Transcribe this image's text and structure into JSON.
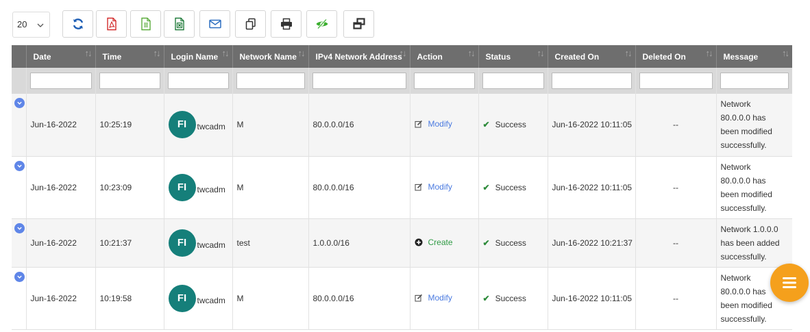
{
  "toolbar": {
    "page_size": "20",
    "buttons": [
      {
        "name": "refresh-button",
        "icon": "refresh-icon",
        "color": "#1f5fb5"
      },
      {
        "name": "export-pdf-button",
        "icon": "pdf-icon",
        "color": "#d22b2b"
      },
      {
        "name": "export-csv-button",
        "icon": "text-file-icon",
        "color": "#5aab3c"
      },
      {
        "name": "export-excel-button",
        "icon": "excel-icon",
        "color": "#1f7a3a"
      },
      {
        "name": "email-button",
        "icon": "mail-icon",
        "color": "#2d6fc0"
      },
      {
        "name": "copy-button",
        "icon": "copy-icon",
        "color": "#333333"
      },
      {
        "name": "print-button",
        "icon": "print-icon",
        "color": "#333333"
      },
      {
        "name": "column-visibility-button",
        "icon": "eye-slash-icon",
        "color": "#3aae2e"
      },
      {
        "name": "restore-window-button",
        "icon": "restore-icon",
        "color": "#333333"
      }
    ]
  },
  "table": {
    "columns": [
      "Date",
      "Time",
      "Login Name",
      "Network Name",
      "IPv4 Network Address",
      "Action",
      "Status",
      "Created On",
      "Deleted On",
      "Message"
    ],
    "rows": [
      {
        "date": "Jun-16-2022",
        "time": "10:25:19",
        "initials": "FI",
        "login": "twcadm",
        "network": "M",
        "address": "80.0.0.0/16",
        "action": "Modify",
        "status": "Success",
        "created": "Jun-16-2022 10:11:05",
        "deleted": "--",
        "message": [
          "Network",
          "80.0.0.0 has",
          "been modified",
          "successfully."
        ]
      },
      {
        "date": "Jun-16-2022",
        "time": "10:23:09",
        "initials": "FI",
        "login": "twcadm",
        "network": "M",
        "address": "80.0.0.0/16",
        "action": "Modify",
        "status": "Success",
        "created": "Jun-16-2022 10:11:05",
        "deleted": "--",
        "message": [
          "Network",
          "80.0.0.0 has",
          "been modified",
          "successfully."
        ]
      },
      {
        "date": "Jun-16-2022",
        "time": "10:21:37",
        "initials": "FI",
        "login": "twcadm",
        "network": "test",
        "address": "1.0.0.0/16",
        "action": "Create",
        "status": "Success",
        "created": "Jun-16-2022 10:21:37",
        "deleted": "--",
        "message": [
          "Network 1.0.0.0",
          "has been added",
          "successfully."
        ]
      },
      {
        "date": "Jun-16-2022",
        "time": "10:19:58",
        "initials": "FI",
        "login": "twcadm",
        "network": "M",
        "address": "80.0.0.0/16",
        "action": "Modify",
        "status": "Success",
        "created": "Jun-16-2022 10:11:05",
        "deleted": "--",
        "message": [
          "Network",
          "80.0.0.0 has",
          "been modified",
          "successfully."
        ]
      }
    ]
  },
  "colors": {
    "header_bg": "#6e6e6e",
    "avatar_bg": "#157f7a",
    "expand_icon": "#5f86e8",
    "modify_link": "#4a7ae0",
    "create_link": "#2f9a44",
    "success_check": "#2e8b3b",
    "fab_bg": "#f5a01c"
  },
  "fab": {
    "icon": "menu-icon"
  }
}
